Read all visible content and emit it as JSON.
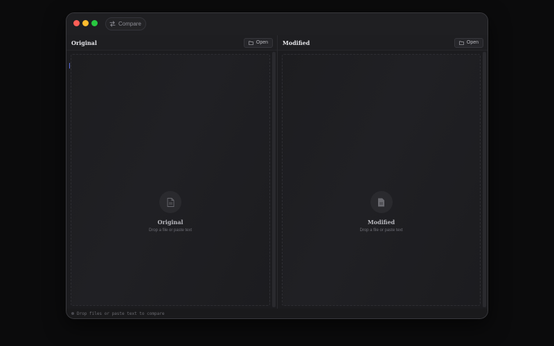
{
  "window": {
    "toolbar": {
      "compare_label": "Compare"
    }
  },
  "panes": [
    {
      "title": "Original",
      "open_label": "Open",
      "drop_title": "Original",
      "drop_hint": "Drop a file or paste text"
    },
    {
      "title": "Modified",
      "open_label": "Open",
      "drop_title": "Modified",
      "drop_hint": "Drop a file or paste text"
    }
  ],
  "status": {
    "text": "Drop files or paste text to compare"
  },
  "colors": {
    "close": "#ff5f57",
    "minimize": "#febc2e",
    "maximize": "#28c840",
    "background": "#1c1c1f",
    "cursor": "#5a6ee0"
  },
  "icons": [
    "compare-arrows-icon",
    "folder-icon",
    "document-icon"
  ]
}
